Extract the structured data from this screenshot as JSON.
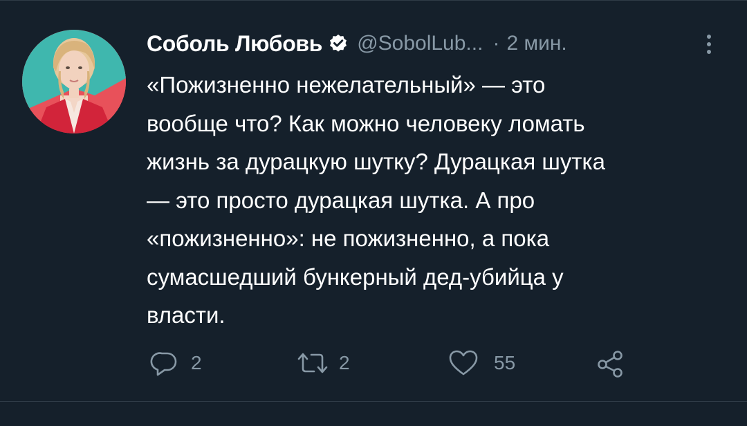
{
  "tweet": {
    "author_name": "Соболь Любовь",
    "handle": "@SobolLub...",
    "separator": "·",
    "time": "2 мин.",
    "verified_icon": "verified-badge-icon",
    "text": "«Пожизненно нежелательный» — это\nвообще что? Как можно человеку ломать\nжизнь за дурацкую шутку? Дурацкая шутка\n— это просто дурацкая шутка. А про\n«пожизненно»: не пожизненно, а пока\nсумасшедший бункерный дед-убийца у\nвласти."
  },
  "actions": {
    "reply": {
      "icon": "reply-icon",
      "count": "2"
    },
    "retweet": {
      "icon": "retweet-icon",
      "count": "2"
    },
    "like": {
      "icon": "heart-icon",
      "count": "55"
    },
    "share": {
      "icon": "share-icon"
    }
  },
  "colors": {
    "background": "#15202b",
    "text_primary": "#ffffff",
    "text_secondary": "#8899a6",
    "divider": "#2f3b47"
  }
}
